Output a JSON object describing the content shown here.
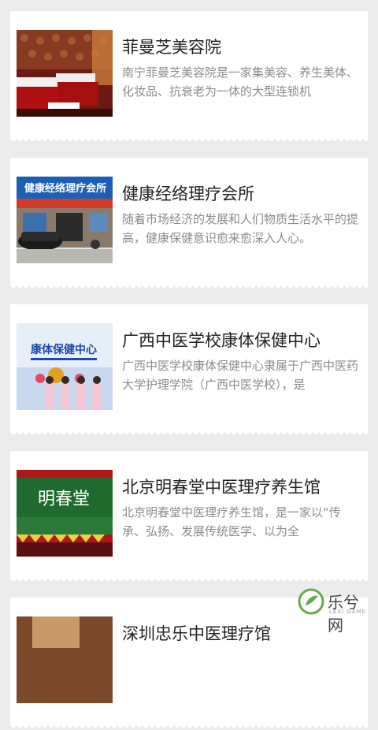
{
  "items": [
    {
      "title": "菲曼芝美容院",
      "desc": "南宁菲曼芝美容院是一家集美容、养生美体、化妆品、抗衰老为一体的大型连锁机"
    },
    {
      "title": "健康经络理疗会所",
      "desc": "随着市场经济的发展和人们物质生活水平的提高，健康保健意识愈来愈深入人心。",
      "sign_text": "健康经络理疗会所"
    },
    {
      "title": "广西中医学校康体保健中心",
      "desc": "广西中医学校康体保健中心隶属于广西中医药大学护理学院（广西中医学校），是",
      "sign_text": "康体保健中心"
    },
    {
      "title": "北京明春堂中医理疗养生馆",
      "desc": "北京明春堂中医理疗养生馆，是一家以“传承、弘扬、发展传统医学、以为全",
      "sign_text": "明春堂"
    },
    {
      "title": "深圳忠乐中医理疗馆",
      "desc": ""
    }
  ],
  "watermark": {
    "text": "乐兮网",
    "sub": "LEXI GAME"
  }
}
